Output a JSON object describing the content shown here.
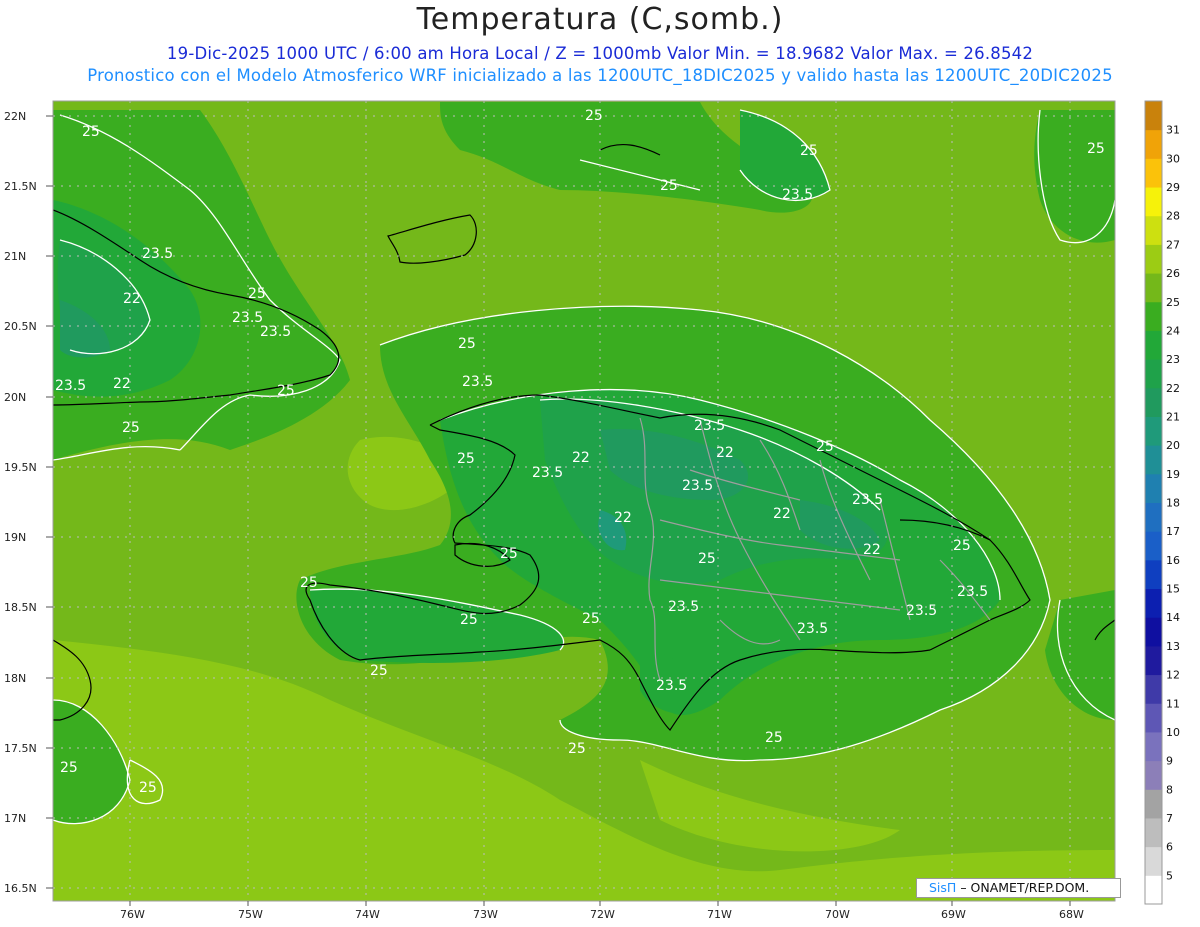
{
  "header": {
    "title": "Temperatura (C,somb.)",
    "line1": "19-Dic-2025  1000 UTC / 6:00 am Hora Local / Z = 1000mb   Valor Min. = 18.9682  Valor Max. = 26.8542",
    "line2": "Pronostico con el Modelo Atmosferico WRF inicializado a las 1200UTC_18DIC2025 y valido hasta las  1200UTC_20DIC2025"
  },
  "axes": {
    "lat_labels": [
      "22N",
      "21.5N",
      "21N",
      "20.5N",
      "20N",
      "19.5N",
      "19N",
      "18.5N",
      "18N",
      "17.5N",
      "17N",
      "16.5N"
    ],
    "lon_labels": [
      "76W",
      "75W",
      "74W",
      "73W",
      "72W",
      "71W",
      "70W",
      "69W",
      "68W"
    ]
  },
  "colorbar": {
    "levels": [
      5,
      6,
      7,
      8,
      9,
      10,
      11,
      12,
      13,
      14,
      15,
      16,
      17,
      18,
      19,
      20,
      21,
      22,
      23,
      24,
      25,
      26,
      27,
      28,
      29,
      30,
      31
    ],
    "colors": [
      "#ffffff",
      "#d9d9d9",
      "#bdbdbd",
      "#a3a3a3",
      "#8c7fb8",
      "#7a72bd",
      "#5e57b5",
      "#3f3aa8",
      "#1f1a9e",
      "#0f0fa0",
      "#0c1fb0",
      "#0f3fc0",
      "#1a5fc8",
      "#1f6fc0",
      "#1f80b0",
      "#1f8f96",
      "#1f9a7a",
      "#209a5e",
      "#1fa24a",
      "#22a838",
      "#3aad20",
      "#74b81a",
      "#9ccc14",
      "#cde010",
      "#f6f20a",
      "#fbc20a",
      "#f0a308",
      "#c9820c"
    ]
  },
  "contour_labels": [
    "25",
    "23.5",
    "22"
  ],
  "credit": {
    "brand": "SisΠ",
    "text": "– ONAMET/REP.DOM."
  },
  "colors": {
    "field_24": "#22a838",
    "field_25": "#3aad20",
    "field_23": "#1fa24a",
    "field_26": "#74b81a",
    "field_27": "#9ccc14",
    "field_22": "#209a5e",
    "field_21": "#1f9a7a",
    "coast": "#000000",
    "border": "#9e9e9e",
    "contour": "#ffffff"
  }
}
